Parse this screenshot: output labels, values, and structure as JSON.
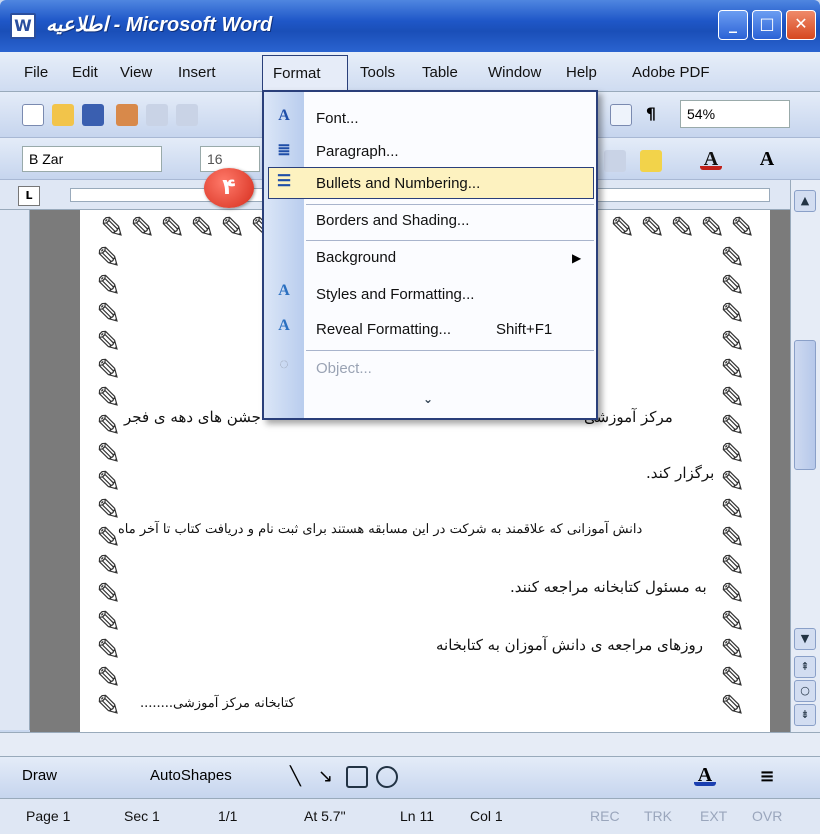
{
  "window": {
    "title": "اطلاعیه - Microsoft Word"
  },
  "menubar": {
    "items": [
      "File",
      "Edit",
      "View",
      "Insert",
      "Format",
      "Tools",
      "Table",
      "Window",
      "Help",
      "Adobe PDF"
    ]
  },
  "toolbar": {
    "font": "B Zar",
    "size": "16",
    "zoom": "54%"
  },
  "format_menu": {
    "items": [
      {
        "label": "Font...",
        "icon": "font-icon"
      },
      {
        "label": "Paragraph...",
        "icon": "paragraph-icon"
      },
      {
        "label": "Bullets and Numbering...",
        "icon": "bullets-icon"
      },
      {
        "label": "Borders and Shading...",
        "icon": ""
      },
      {
        "label": "Background",
        "icon": ""
      },
      {
        "label": "Styles and Formatting...",
        "icon": "styles-icon"
      },
      {
        "label": "Reveal Formatting...",
        "shortcut": "Shift+F1",
        "icon": "reveal-icon"
      },
      {
        "label": "Object...",
        "icon": "object-icon"
      }
    ]
  },
  "callout": {
    "label": "۴"
  },
  "document": {
    "lines": [
      "مرکز آموزشی",
      "جشن های دهه ی فجر",
      "برگزار کند.",
      "دانش آموزانی که علاقمند به شرکت در این مسابقه هستند برای ثبت نام و دریافت کتاب تا آخر ماه",
      "به مسئول کتابخانه مراجعه کنند.",
      "روزهای مراجعه ی دانش آموزان به کتابخانه",
      "کتابخانه مرکز آموزشی........"
    ]
  },
  "drawbar": {
    "draw": "Draw",
    "autoshapes": "AutoShapes"
  },
  "status": {
    "page": "Page 1",
    "sec": "Sec 1",
    "pages": "1/1",
    "at": "At 5.7\"",
    "ln": "Ln 11",
    "col": "Col 1",
    "rec": "REC",
    "trk": "TRK",
    "ext": "EXT",
    "ovr": "OVR"
  }
}
